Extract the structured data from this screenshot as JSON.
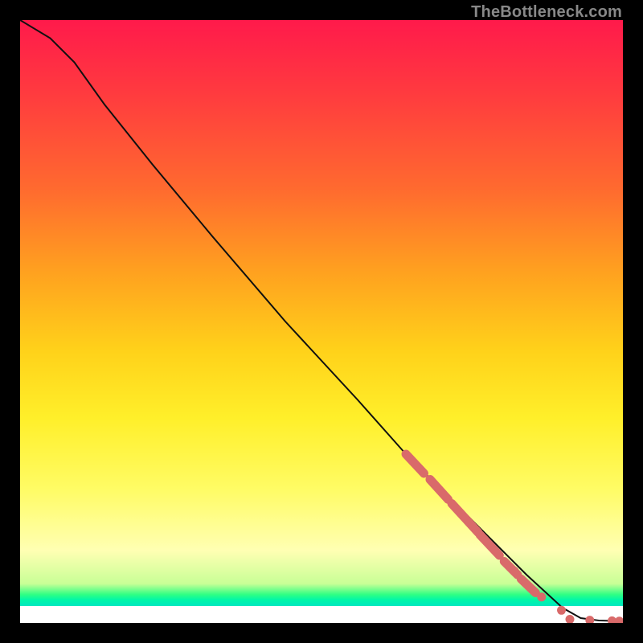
{
  "attribution": "TheBottleneck.com",
  "chart_data": {
    "type": "line",
    "title": "",
    "xlabel": "",
    "ylabel": "",
    "xlim": [
      0,
      100
    ],
    "ylim": [
      0,
      100
    ],
    "grid": false,
    "legend": false,
    "curve": [
      {
        "x": 0,
        "y": 100
      },
      {
        "x": 5,
        "y": 97
      },
      {
        "x": 9,
        "y": 93
      },
      {
        "x": 14,
        "y": 86
      },
      {
        "x": 22,
        "y": 76
      },
      {
        "x": 32,
        "y": 64
      },
      {
        "x": 44,
        "y": 50
      },
      {
        "x": 56,
        "y": 37
      },
      {
        "x": 64,
        "y": 28
      },
      {
        "x": 72,
        "y": 20
      },
      {
        "x": 78,
        "y": 14
      },
      {
        "x": 84,
        "y": 8
      },
      {
        "x": 90,
        "y": 2.5
      },
      {
        "x": 93,
        "y": 0.8
      },
      {
        "x": 96,
        "y": 0.4
      },
      {
        "x": 100,
        "y": 0.3
      }
    ],
    "marker_segments": [
      {
        "x0": 64,
        "y0": 28,
        "x1": 67,
        "y1": 24.8
      },
      {
        "x0": 68,
        "y0": 23.8,
        "x1": 71,
        "y1": 20.5
      },
      {
        "x0": 71.6,
        "y0": 19.8,
        "x1": 76,
        "y1": 15
      },
      {
        "x0": 76.3,
        "y0": 14.6,
        "x1": 79.5,
        "y1": 11.2
      },
      {
        "x0": 80.3,
        "y0": 10.2,
        "x1": 82.5,
        "y1": 8
      },
      {
        "x0": 83.1,
        "y0": 7.3,
        "x1": 85.5,
        "y1": 5
      }
    ],
    "marker_points": [
      {
        "x": 82,
        "y": 8.6
      },
      {
        "x": 86.5,
        "y": 4.3
      },
      {
        "x": 89.8,
        "y": 2.1
      },
      {
        "x": 91.2,
        "y": 0.6
      },
      {
        "x": 94.5,
        "y": 0.45
      },
      {
        "x": 98.2,
        "y": 0.35
      },
      {
        "x": 99.4,
        "y": 0.3
      }
    ],
    "colors": {
      "curve": "#101010",
      "markers": "#d96a6a",
      "gradient_top": "#ff1a4b",
      "gradient_mid": "#ffe81a",
      "gradient_band": "#00f29a",
      "gradient_bottom": "#ffffff"
    }
  }
}
